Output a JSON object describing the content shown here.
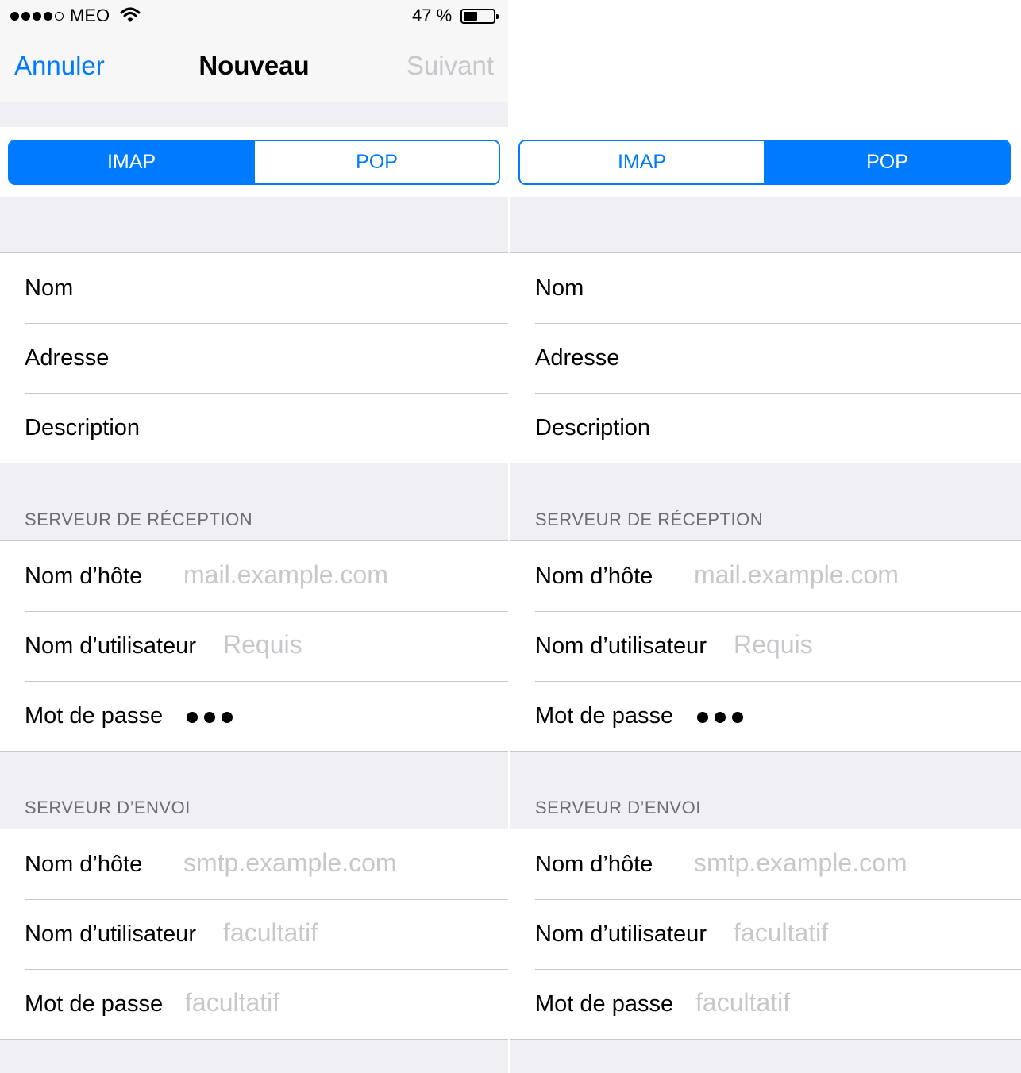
{
  "status_bar": {
    "carrier": "MEO",
    "battery": "47 %",
    "battery_level": 0.47
  },
  "nav": {
    "cancel": "Annuler",
    "title": "Nouveau",
    "next": "Suivant"
  },
  "segment": {
    "imap": "IMAP",
    "pop": "POP"
  },
  "panels": {
    "left": {
      "selected": "IMAP"
    },
    "right": {
      "selected": "POP"
    }
  },
  "account": {
    "name_label": "Nom",
    "address_label": "Adresse",
    "description_label": "Description"
  },
  "incoming": {
    "header": "SERVEUR DE RÉCEPTION",
    "host_label": "Nom d’hôte",
    "host_placeholder": "mail.example.com",
    "user_label": "Nom d’utilisateur",
    "user_placeholder": "Requis",
    "password_label": "Mot de passe"
  },
  "outgoing": {
    "header": "SERVEUR D’ENVOI",
    "host_label": "Nom d’hôte",
    "host_placeholder": "smtp.example.com",
    "user_label": "Nom d’utilisateur",
    "user_placeholder": "facultatif",
    "password_label": "Mot de passe",
    "password_placeholder": "facultatif"
  },
  "colors": {
    "accent": "#007aff",
    "placeholder": "#c7c7cc",
    "group_bg": "#efeff4",
    "header_text": "#6d6d72"
  }
}
